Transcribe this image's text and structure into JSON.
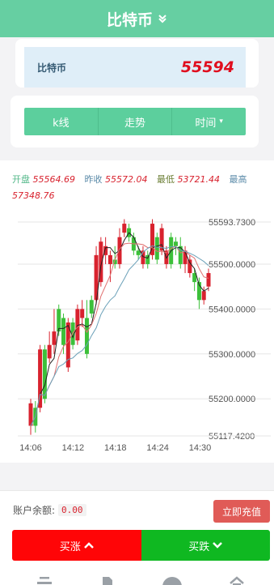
{
  "header": {
    "title": "比特币",
    "dropdown_icon": "double-chevron-down-icon"
  },
  "quote": {
    "symbol": "比特币",
    "price": "55594"
  },
  "tabs": [
    {
      "label": "k线"
    },
    {
      "label": "走势"
    },
    {
      "label": "时间",
      "caret": "▾"
    }
  ],
  "ohlc": {
    "open_label": "开盘",
    "open": "55564.69",
    "prev_label": "昨收",
    "prev": "55572.04",
    "low_label": "最低",
    "low": "53721.44",
    "high_label": "最高",
    "high": "57348.76"
  },
  "chart_data": {
    "type": "candlestick",
    "y_ticks": [
      "55593.7300",
      "55500.0000",
      "55400.0000",
      "55300.0000",
      "55200.0000",
      "55117.4200"
    ],
    "x_ticks": [
      "14:06",
      "14:12",
      "14:18",
      "14:24",
      "14:30"
    ],
    "candles": [
      [
        55190,
        55140,
        55200,
        55120,
        "red"
      ],
      [
        55140,
        55180,
        55195,
        55125,
        "green"
      ],
      [
        55180,
        55310,
        55320,
        55170,
        "red"
      ],
      [
        55310,
        55200,
        55320,
        55190,
        "green"
      ],
      [
        55290,
        55320,
        55350,
        55280,
        "red"
      ],
      [
        55320,
        55350,
        55400,
        55300,
        "red"
      ],
      [
        55350,
        55400,
        55410,
        55340,
        "green"
      ],
      [
        55380,
        55320,
        55390,
        55300,
        "green"
      ],
      [
        55270,
        55370,
        55380,
        55260,
        "red"
      ],
      [
        55370,
        55320,
        55380,
        55310,
        "green"
      ],
      [
        55330,
        55400,
        55410,
        55320,
        "red"
      ],
      [
        55400,
        55380,
        55420,
        55360,
        "red"
      ],
      [
        55380,
        55300,
        55420,
        55290,
        "green"
      ],
      [
        55390,
        55420,
        55430,
        55380,
        "green"
      ],
      [
        55420,
        55520,
        55540,
        55410,
        "red"
      ],
      [
        55460,
        55550,
        55560,
        55450,
        "red"
      ],
      [
        55520,
        55540,
        55560,
        55500,
        "red"
      ],
      [
        55500,
        55520,
        55530,
        55460,
        "red"
      ],
      [
        55500,
        55510,
        55540,
        55490,
        "green"
      ],
      [
        55500,
        55560,
        55580,
        55490,
        "red"
      ],
      [
        55570,
        55590,
        55600,
        55560,
        "red"
      ],
      [
        55580,
        55560,
        55590,
        55550,
        "green"
      ],
      [
        55560,
        55530,
        55570,
        55520,
        "green"
      ],
      [
        55530,
        55520,
        55540,
        55510,
        "green"
      ],
      [
        55530,
        55500,
        55540,
        55490,
        "red"
      ],
      [
        55500,
        55520,
        55530,
        55490,
        "green"
      ],
      [
        55520,
        55590,
        55600,
        55510,
        "red"
      ],
      [
        55560,
        55510,
        55570,
        55500,
        "green"
      ],
      [
        55580,
        55530,
        55590,
        55520,
        "red"
      ],
      [
        55530,
        55500,
        55540,
        55490,
        "red"
      ],
      [
        55500,
        55560,
        55570,
        55490,
        "green"
      ],
      [
        55540,
        55550,
        55560,
        55520,
        "green"
      ],
      [
        55540,
        55500,
        55560,
        55490,
        "green"
      ],
      [
        55500,
        55530,
        55540,
        55480,
        "red"
      ],
      [
        55510,
        55480,
        55520,
        55470,
        "red"
      ],
      [
        55480,
        55460,
        55490,
        55440,
        "green"
      ],
      [
        55460,
        55420,
        55470,
        55400,
        "green"
      ],
      [
        55420,
        55440,
        55450,
        55410,
        "red"
      ],
      [
        55450,
        55480,
        55490,
        55440,
        "red"
      ]
    ],
    "ylim": [
      55117.42,
      55593.73
    ],
    "colors": {
      "up": "#d8222e",
      "down": "#3cc03a",
      "ma1": "#222222",
      "ma2": "#e07070",
      "ma3": "#6aa0b8",
      "ma4": "#4a8a3a"
    }
  },
  "account": {
    "balance_label": "账户余额:",
    "balance": "0.00",
    "recharge_label": "立即充值"
  },
  "actions": {
    "buy_up_label": "买涨",
    "buy_down_label": "买跌"
  },
  "nav": [
    "menu-icon",
    "document-icon",
    "home-icon",
    "house-icon"
  ]
}
